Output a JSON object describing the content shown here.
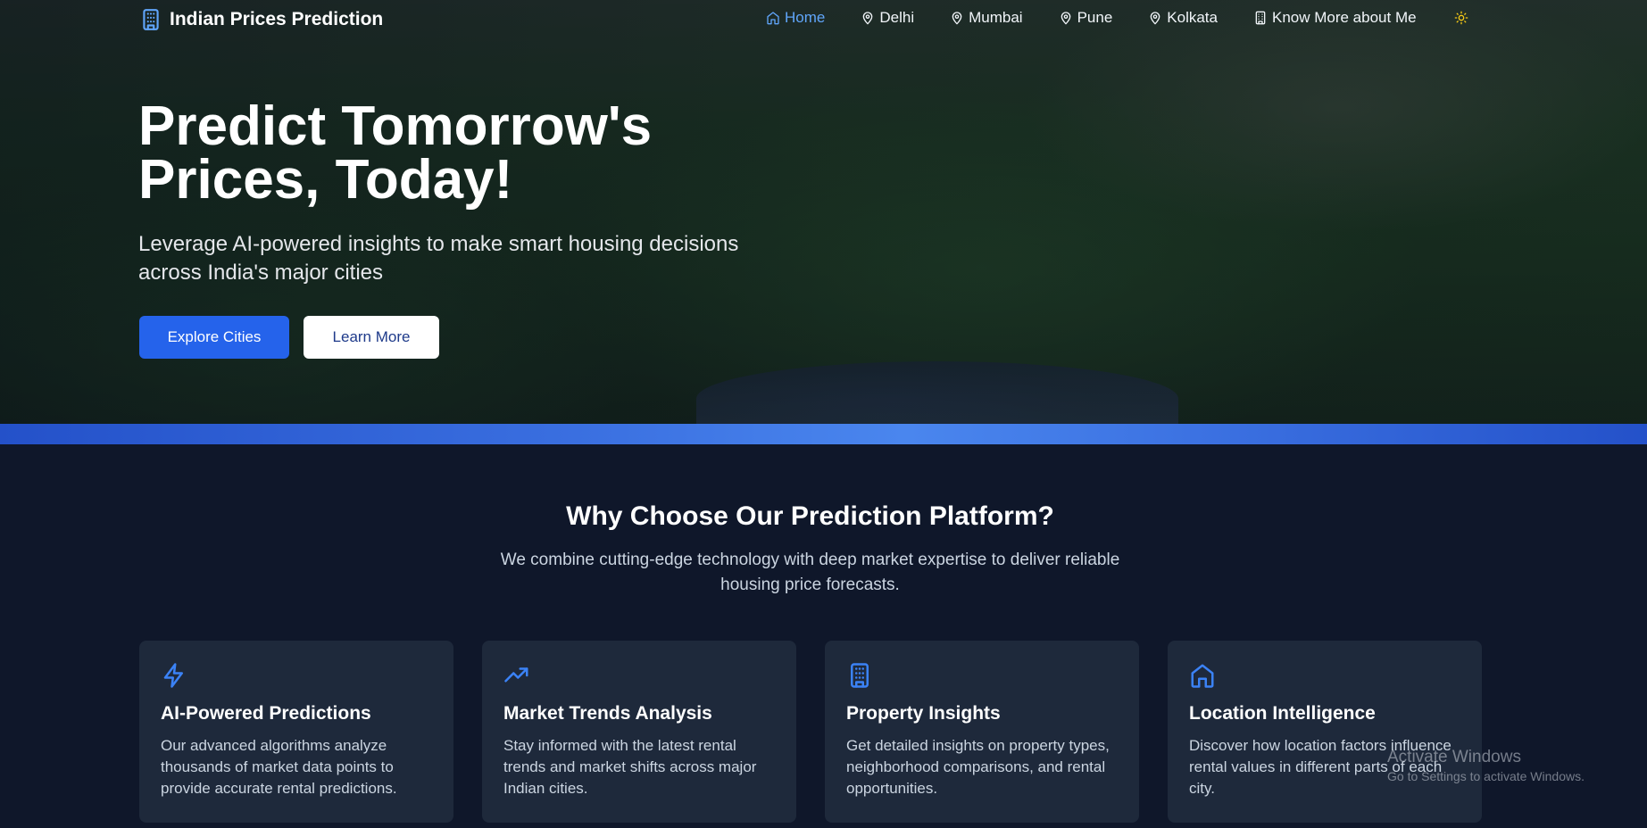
{
  "brand": {
    "title": "Indian Prices Prediction",
    "icon": "building-icon"
  },
  "nav": {
    "items": [
      {
        "label": "Home",
        "icon": "home-icon",
        "active": true
      },
      {
        "label": "Delhi",
        "icon": "map-pin-icon"
      },
      {
        "label": "Mumbai",
        "icon": "map-pin-icon"
      },
      {
        "label": "Pune",
        "icon": "map-pin-icon"
      },
      {
        "label": "Kolkata",
        "icon": "map-pin-icon"
      },
      {
        "label": "Know More about Me",
        "icon": "building-icon"
      }
    ],
    "theme_toggle_icon": "sun-icon"
  },
  "hero": {
    "title_line1": "Predict Tomorrow's",
    "title_line2": "Prices, Today!",
    "subtitle_line1": "Leverage AI-powered insights to make smart housing decisions",
    "subtitle_line2": "across India's major cities",
    "primary_button": "Explore Cities",
    "secondary_button": "Learn More"
  },
  "features": {
    "title": "Why Choose Our Prediction Platform?",
    "subtitle_line1": "We combine cutting-edge technology with deep market expertise to deliver reliable",
    "subtitle_line2": "housing price forecasts.",
    "cards": [
      {
        "icon": "lightning-icon",
        "title": "AI-Powered Predictions",
        "text_lines": [
          "Our advanced algorithms analyze",
          "thousands of market data points to",
          "provide accurate rental predictions."
        ]
      },
      {
        "icon": "trending-up-icon",
        "title": "Market Trends Analysis",
        "text_lines": [
          "Stay informed with the latest rental",
          "trends and market shifts across major",
          "Indian cities."
        ]
      },
      {
        "icon": "building-icon",
        "title": "Property Insights",
        "text_lines": [
          "Get detailed insights on property types,",
          "neighborhood comparisons, and rental",
          "opportunities."
        ]
      },
      {
        "icon": "home-icon",
        "title": "Location Intelligence",
        "text_lines": [
          "Discover how location factors influence",
          "rental values in different parts of each",
          "city."
        ]
      }
    ]
  },
  "watermark": {
    "line1": "Activate Windows",
    "line2": "Go to Settings to activate Windows."
  },
  "colors": {
    "accent": "#2563eb",
    "accent_light": "#60a5fa",
    "bg": "#0f172a",
    "card": "#1e293b",
    "sun": "#facc15"
  }
}
